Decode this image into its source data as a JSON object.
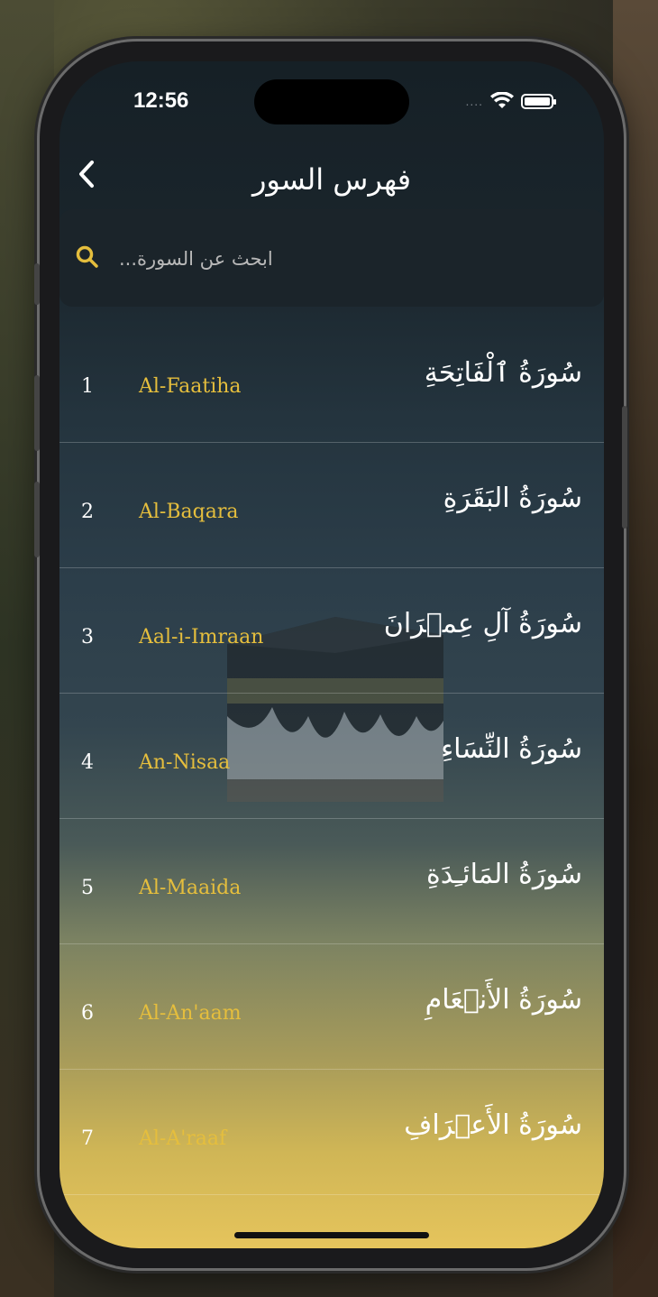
{
  "status_bar": {
    "time": "12:56",
    "icons": [
      "cellular-dots-icon",
      "wifi-icon",
      "battery-icon"
    ],
    "signal_dots": "...."
  },
  "nav": {
    "title": "فهرس السور",
    "back_icon": "chevron-left-icon"
  },
  "search": {
    "placeholder": "...ابحث عن السورة",
    "value": "",
    "icon": "search-icon"
  },
  "colors": {
    "accent_gold": "#e5be3d",
    "text_white": "#ffffff",
    "bg_top": "#162026",
    "bg_bottom": "#e5c45c"
  },
  "surahs": [
    {
      "number": "1",
      "latin": "Al-Faatiha",
      "arabic": "سُورَةُ ٱلْفَاتِحَةِ"
    },
    {
      "number": "2",
      "latin": "Al-Baqara",
      "arabic": "سُورَةُ البَقَرَةِ"
    },
    {
      "number": "3",
      "latin": "Aal-i-Imraan",
      "arabic": "سُورَةُ آلِ عِمۡرَانَ"
    },
    {
      "number": "4",
      "latin": "An-Nisaa",
      "arabic": "سُورَةُ النِّسَاءِ"
    },
    {
      "number": "5",
      "latin": "Al-Maaida",
      "arabic": "سُورَةُ المَائـِدَةِ"
    },
    {
      "number": "6",
      "latin": "Al-An'aam",
      "arabic": "سُورَةُ الأَنۡعَامِ"
    },
    {
      "number": "7",
      "latin": "Al-A'raaf",
      "arabic": "سُورَةُ الأَعۡرَافِ"
    }
  ],
  "background_image": "kaaba-image"
}
